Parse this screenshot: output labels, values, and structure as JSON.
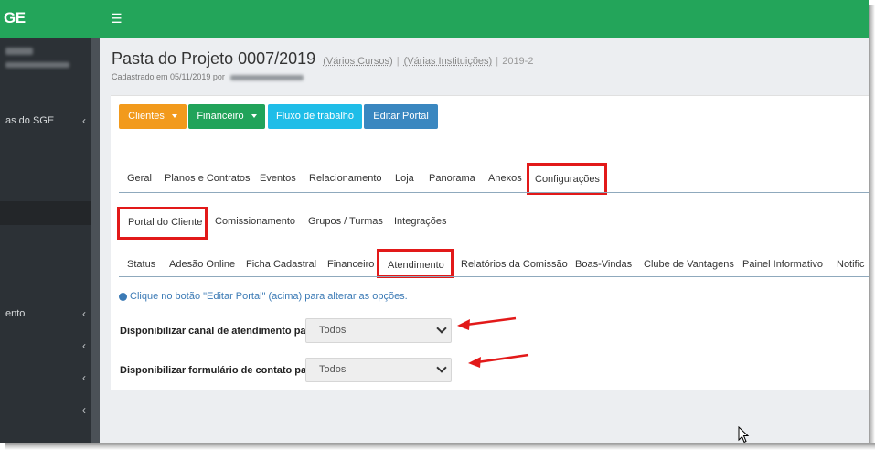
{
  "topbar": {
    "logo": "GE",
    "menu_icon": "hamburger-icon"
  },
  "sidebar": {
    "items": [
      {
        "label": "as do SGE",
        "top": 0
      },
      {
        "label": "ento"
      }
    ]
  },
  "header": {
    "title": "Pasta do Projeto 0007/2019",
    "courses": "(Vários Cursos)",
    "institutions": "(Várias Instituições)",
    "separator": "|",
    "year": "2019-2",
    "created": "Cadastrado em 05/11/2019 por"
  },
  "toolbar": {
    "clientes": "Clientes",
    "financeiro": "Financeiro",
    "fluxo": "Fluxo de trabalho",
    "editar": "Editar Portal",
    "colors": {
      "clientes": "#f29a1c",
      "financeiro": "#21a35a",
      "fluxo": "#1fbde8",
      "editar": "#3a87c0"
    }
  },
  "tabs_main": [
    "Geral",
    "Planos e Contratos",
    "Eventos",
    "Relacionamento",
    "Loja",
    "Panorama",
    "Anexos",
    "Configurações"
  ],
  "tabs_config": [
    "Portal do Cliente",
    "Comissionamento",
    "Grupos / Turmas",
    "Integrações"
  ],
  "tabs_portal": [
    "Status",
    "Adesão Online",
    "Ficha Cadastral",
    "Financeiro",
    "Atendimento",
    "Relatórios da Comissão",
    "Boas-Vindas",
    "Clube de Vantagens",
    "Painel Informativo",
    "Notific"
  ],
  "info_text": "Clique no botão \"Editar Portal\" (acima) para alterar as opções.",
  "form": {
    "field1_label": "Disponibilizar canal de atendimento para",
    "field1_value": "Todos",
    "field2_label": "Disponibilizar formulário de contato para",
    "field2_value": "Todos"
  },
  "accent": {
    "highlight": "#e21919",
    "topbar": "#23a55a",
    "sidebar": "#2c3136"
  }
}
